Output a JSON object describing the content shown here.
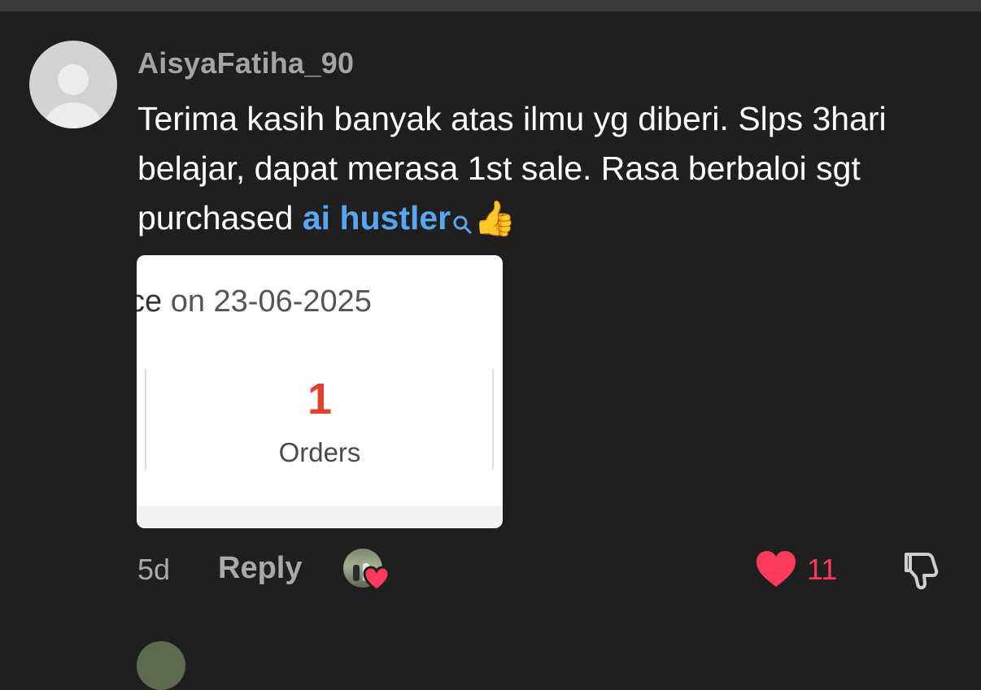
{
  "comment": {
    "username": "AisyaFatiha_90",
    "text_before_tag": "Terima kasih banyak atas ilmu yg diberi. Slps 3hari belajar, dapat merasa 1st sale. Rasa berbaloi sgt purchased ",
    "hashtag": "ai hustler",
    "emoji": "👍",
    "attachment": {
      "date_prefix": "ce",
      "date_text": "on 23-06-2025",
      "count": "1",
      "count_label": "Orders"
    },
    "age": "5d",
    "reply_label": "Reply",
    "like_count": "11"
  },
  "colors": {
    "background": "#1f1f1f",
    "link": "#58a6f2",
    "like": "#ff3b5c",
    "orders_count": "#e3432c"
  },
  "icons": {
    "search": "search-icon",
    "like": "heart-icon",
    "dislike": "thumbs-down-icon"
  }
}
